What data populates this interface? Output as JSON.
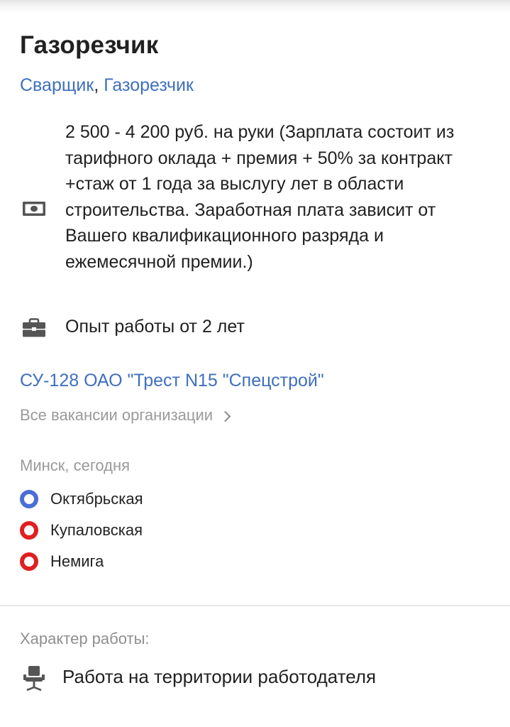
{
  "vacancy": {
    "title": "Газорезчик",
    "specializations": [
      {
        "label": "Сварщик"
      },
      {
        "label": "Газорезчик"
      }
    ],
    "specializations_separator": ", ",
    "salary_text": "2 500 - 4 200 руб. на руки (Зарплата состоит из тарифного оклада + премия + 50% за контракт +стаж от 1 года за выслугу лет в области строительства. Заработная плата зависит от Вашего квалификационного разряда и ежемесячной премии.)",
    "experience_text": "Опыт работы от 2 лет"
  },
  "company": {
    "name": "СУ-128 ОАО \"Трест N15 \"Спецстрой\"",
    "all_vacancies_label": "Все вакансии организации"
  },
  "location": {
    "city_date": "Минск, сегодня",
    "metro": [
      {
        "name": "Октябрьская",
        "color": "#4a6fd6"
      },
      {
        "name": "Купаловская",
        "color": "#e02020"
      },
      {
        "name": "Немига",
        "color": "#e02020"
      }
    ]
  },
  "work_character": {
    "label": "Характер работы:",
    "value": "Работа на территории работодателя"
  },
  "icons": {
    "salary": "money-icon",
    "experience": "briefcase-icon",
    "work_place": "office-chair-icon",
    "more": "chevron-right-icon"
  },
  "colors": {
    "link": "#3f6fbf",
    "secondary_text": "#9a9a9a",
    "icon": "#555555"
  }
}
